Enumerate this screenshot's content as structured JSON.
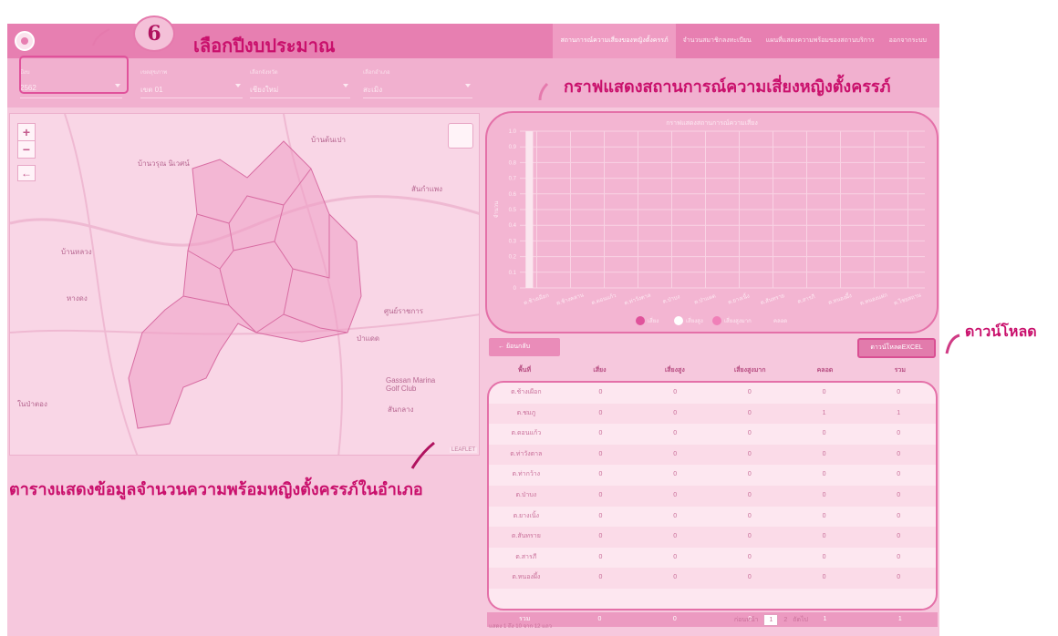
{
  "nav": {
    "items": [
      "สถานการณ์ความเสี่ยงของหญิงตั้งครรภ์",
      "จำนวนสมาชิกลงทะเบียน",
      "แผนที่แสดงความพร้อมของสถานบริการ",
      "ออกจากระบบ"
    ]
  },
  "filters": [
    {
      "label": "ปีงบ",
      "value": "2562"
    },
    {
      "label": "เขตสุขภาพ",
      "value": "เขต 01"
    },
    {
      "label": "เลือกจังหวัด",
      "value": "เชียงใหม่"
    },
    {
      "label": "เลือกอำเภอ",
      "value": "สะเมิง"
    }
  ],
  "annotations": {
    "step_number": "6",
    "select_year": "เลือกปีงบประมาณ",
    "chart_caption": "กราฟแสดงสถานการณ์ความเสี่ยงหญิงตั้งครรภ์",
    "download_caption": "ดาวน์โหลด",
    "table_caption": "ตารางแสดงข้อมูลจำนวนความพร้อมหญิงตั้งครรภ์ในอำเภอ"
  },
  "map": {
    "labels": [
      "บ้านต้นเปา",
      "สันกำแพง",
      "บ้านวรุณ นิเวศน์",
      "บ้านหลวง",
      "หางดง",
      "ศูนย์ราชการ",
      "Gassan Marina Golf Club",
      "สันกลาง",
      "ป่าแดด",
      "ในป่าตอง"
    ],
    "attribution": "LEAFLET"
  },
  "chart_data": {
    "type": "bar",
    "title": "กราฟแสดงสถานการณ์ความเสี่ยง",
    "ylabel": "จำนวน",
    "ylim": [
      0,
      1.0
    ],
    "yticks": [
      "0",
      "0.1",
      "0.2",
      "0.3",
      "0.4",
      "0.5",
      "0.6",
      "0.7",
      "0.8",
      "0.9",
      "1.0"
    ],
    "categories": [
      "ต.ช้างเผือก",
      "ต.ช้างคลาน",
      "ต.ดอนแก้ว",
      "ต.ท่าวังตาล",
      "ต.ป่าบง",
      "ต.ป่าแดด",
      "ต.ยางเนิ้ง",
      "ต.สันทราย",
      "ต.สารภี",
      "ต.หนองผึ้ง",
      "ต.หนองแฝก",
      "ต.ไชยสถาน"
    ],
    "series": [
      {
        "name": "เสี่ยง",
        "color": "#e0529b",
        "values": [
          1.0,
          0,
          0,
          0,
          0,
          0,
          0,
          0,
          0,
          0,
          0,
          0
        ]
      },
      {
        "name": "เสี่ยงสูง",
        "color": "#ffffff",
        "values": [
          0,
          0,
          0,
          0,
          0,
          0,
          0,
          0,
          0,
          0,
          0,
          0
        ]
      },
      {
        "name": "เสี่ยงสูงมาก",
        "color": "#f080b8",
        "values": [
          0,
          0,
          0,
          0,
          0,
          0,
          0,
          0,
          0,
          0,
          0,
          0
        ]
      }
    ],
    "legend_extra": "คลอด",
    "legend_position": "bottom"
  },
  "buttons": {
    "back": "ย้อนกลับ",
    "download_excel": "ดาวน์โหลดEXCEL"
  },
  "table": {
    "headers": [
      "พื้นที่",
      "เสี่ยง",
      "เสี่ยงสูง",
      "เสี่ยงสูงมาก",
      "คลอด",
      "รวม"
    ],
    "rows": [
      [
        "ต.ช้างเผือก",
        "0",
        "0",
        "0",
        "0",
        "0"
      ],
      [
        "ต.ชมภู",
        "0",
        "0",
        "0",
        "1",
        "1"
      ],
      [
        "ต.ดอนแก้ว",
        "0",
        "0",
        "0",
        "0",
        "0"
      ],
      [
        "ต.ท่าวังตาล",
        "0",
        "0",
        "0",
        "0",
        "0"
      ],
      [
        "ต.ท่ากว้าง",
        "0",
        "0",
        "0",
        "0",
        "0"
      ],
      [
        "ต.ป่าบง",
        "0",
        "0",
        "0",
        "0",
        "0"
      ],
      [
        "ต.ยางเนิ้ง",
        "0",
        "0",
        "0",
        "0",
        "0"
      ],
      [
        "ต.สันทราย",
        "0",
        "0",
        "0",
        "0",
        "0"
      ],
      [
        "ต.สารภี",
        "0",
        "0",
        "0",
        "0",
        "0"
      ],
      [
        "ต.หนองผึ้ง",
        "0",
        "0",
        "0",
        "0",
        "0"
      ]
    ],
    "total": [
      "รวม",
      "0",
      "0",
      "0",
      "1",
      "1"
    ],
    "info": "แสดง 1 ถึง 10 จาก 12 แถว",
    "pager": {
      "prev": "ก่อนหน้า",
      "pages": [
        "1",
        "2"
      ],
      "next": "ถัดไป"
    }
  }
}
